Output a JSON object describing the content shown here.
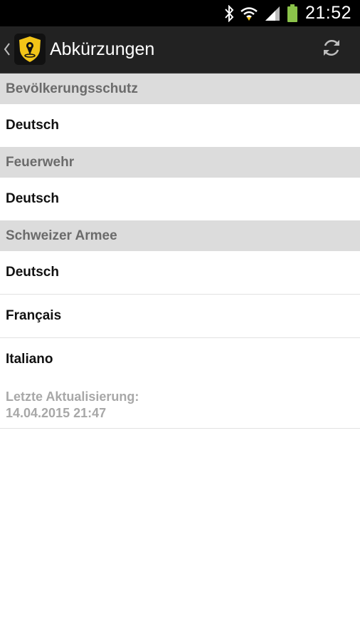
{
  "status_bar": {
    "time": "21:52",
    "icons": [
      "bluetooth-icon",
      "wifi-icon",
      "signal-icon",
      "battery-icon"
    ],
    "battery_color": "#8bc34a"
  },
  "action_bar": {
    "title": "Abkürzungen",
    "app_icon": "shield-location-icon",
    "back_icon": "chevron-left-icon",
    "refresh_icon": "refresh-icon",
    "accent": "#f2c418"
  },
  "sections": [
    {
      "header": "Bevölkerungsschutz",
      "items": [
        "Deutsch"
      ]
    },
    {
      "header": "Feuerwehr",
      "items": [
        "Deutsch"
      ]
    },
    {
      "header": "Schweizer Armee",
      "items": [
        "Deutsch",
        "Français",
        "Italiano"
      ]
    }
  ],
  "footer": {
    "label": "Letzte Aktualisierung:",
    "value": "14.04.2015 21:47"
  }
}
